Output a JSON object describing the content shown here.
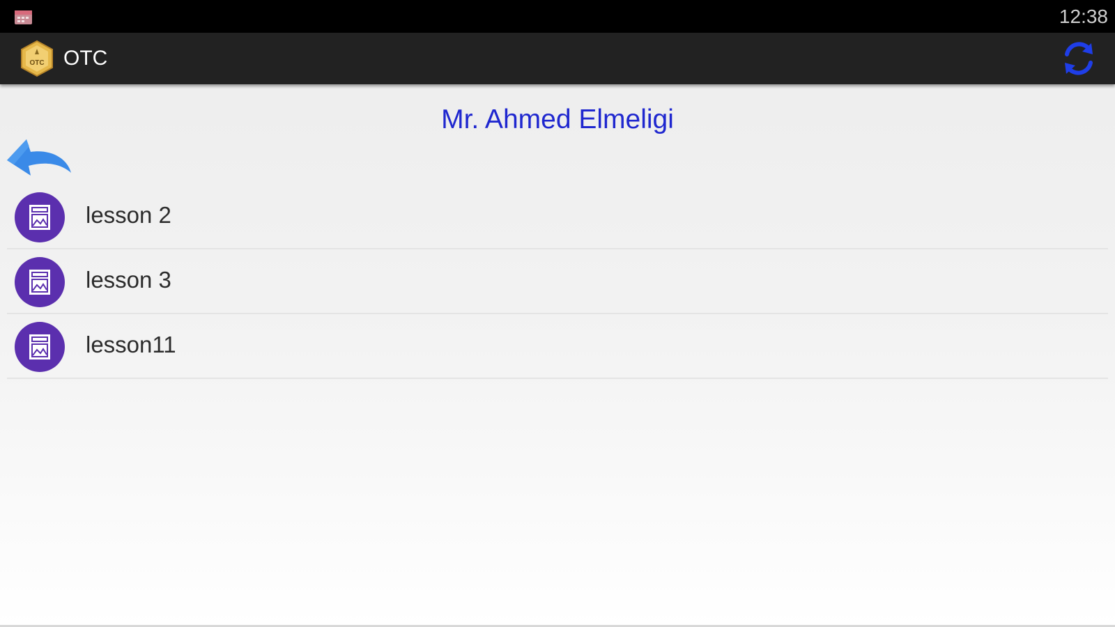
{
  "status_bar": {
    "time": "12:38",
    "notification_icon": "calendar-icon"
  },
  "action_bar": {
    "title": "OTC",
    "logo_icon": "otc-logo-icon",
    "logo_text": "OTC",
    "refresh_icon": "refresh-icon",
    "accent_color": "#1f3ee8"
  },
  "page": {
    "title": "Mr. Ahmed Elmeligi",
    "title_color": "#1f27cf",
    "back_icon": "back-arrow-icon"
  },
  "lessons": [
    {
      "label": "lesson 2",
      "icon": "lesson-image-icon"
    },
    {
      "label": "lesson 3",
      "icon": "lesson-image-icon"
    },
    {
      "label": "lesson11",
      "icon": "lesson-image-icon"
    }
  ],
  "colors": {
    "status_bar_bg": "#000000",
    "action_bar_bg": "#222222",
    "lesson_icon_bg": "#5b2fae",
    "back_arrow": "#3a8ae8"
  }
}
